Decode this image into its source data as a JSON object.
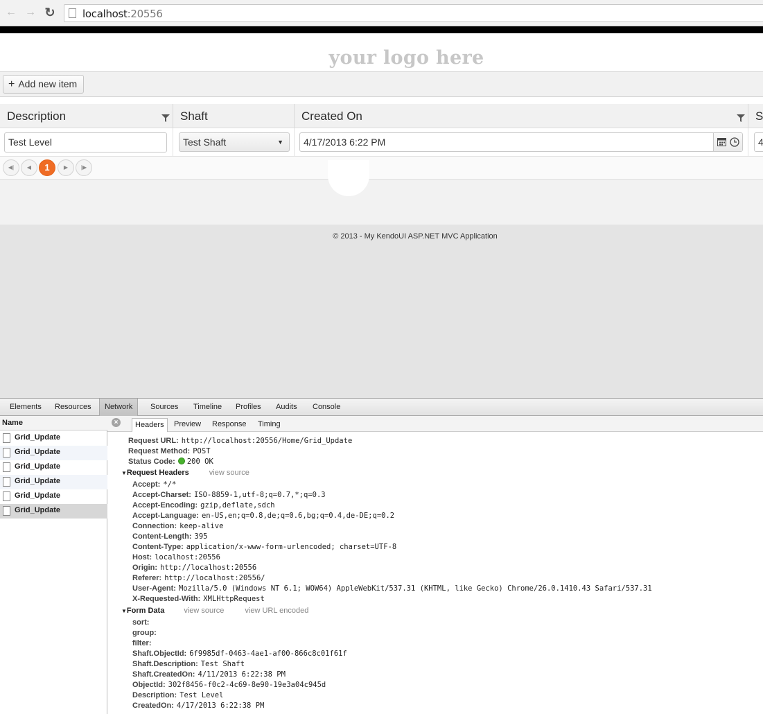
{
  "browser": {
    "url_host": "localhost",
    "url_port": ":20556"
  },
  "site": {
    "logo": "your logo here",
    "add_button": "Add new item",
    "footer": "© 2013 - My KendoUI ASP.NET MVC Application"
  },
  "grid": {
    "columns": [
      "Description",
      "Shaft",
      "Created On",
      "S"
    ],
    "edit_row": {
      "description": "Test Level",
      "shaft": "Test Shaft",
      "created_on": "4/17/2013 6:22 PM",
      "overflow": "4"
    },
    "pager": {
      "current_page": "1"
    }
  },
  "devtools": {
    "tabs": [
      "Elements",
      "Resources",
      "Network",
      "Sources",
      "Timeline",
      "Profiles",
      "Audits",
      "Console"
    ],
    "active_tab": "Network",
    "name_header": "Name",
    "requests": [
      "Grid_Update",
      "Grid_Update",
      "Grid_Update",
      "Grid_Update",
      "Grid_Update",
      "Grid_Update"
    ],
    "sub_tabs": [
      "Headers",
      "Preview",
      "Response",
      "Timing"
    ],
    "general": {
      "request_url_label": "Request URL:",
      "request_url": "http://localhost:20556/Home/Grid_Update",
      "request_method_label": "Request Method:",
      "request_method": "POST",
      "status_code_label": "Status Code:",
      "status_code": "200 OK"
    },
    "request_headers_title": "Request Headers",
    "view_source": "view source",
    "request_headers": [
      {
        "k": "Accept:",
        "v": "*/*"
      },
      {
        "k": "Accept-Charset:",
        "v": "ISO-8859-1,utf-8;q=0.7,*;q=0.3"
      },
      {
        "k": "Accept-Encoding:",
        "v": "gzip,deflate,sdch"
      },
      {
        "k": "Accept-Language:",
        "v": "en-US,en;q=0.8,de;q=0.6,bg;q=0.4,de-DE;q=0.2"
      },
      {
        "k": "Connection:",
        "v": "keep-alive"
      },
      {
        "k": "Content-Length:",
        "v": "395"
      },
      {
        "k": "Content-Type:",
        "v": "application/x-www-form-urlencoded; charset=UTF-8"
      },
      {
        "k": "Host:",
        "v": "localhost:20556"
      },
      {
        "k": "Origin:",
        "v": "http://localhost:20556"
      },
      {
        "k": "Referer:",
        "v": "http://localhost:20556/"
      },
      {
        "k": "User-Agent:",
        "v": "Mozilla/5.0 (Windows NT 6.1; WOW64) AppleWebKit/537.31 (KHTML, like Gecko) Chrome/26.0.1410.43 Safari/537.31"
      },
      {
        "k": "X-Requested-With:",
        "v": "XMLHttpRequest"
      }
    ],
    "form_data_title": "Form Data",
    "view_url_encoded": "view URL encoded",
    "form_data": [
      {
        "k": "sort:",
        "v": ""
      },
      {
        "k": "group:",
        "v": ""
      },
      {
        "k": "filter:",
        "v": ""
      },
      {
        "k": "Shaft.ObjectId:",
        "v": "6f9985df-0463-4ae1-af00-866c8c01f61f"
      },
      {
        "k": "Shaft.Description:",
        "v": "Test Shaft"
      },
      {
        "k": "Shaft.CreatedOn:",
        "v": "4/11/2013 6:22:38 PM"
      },
      {
        "k": "ObjectId:",
        "v": "302f8456-f0c2-4c69-8e90-19e3a04c945d"
      },
      {
        "k": "Description:",
        "v": "Test Level"
      },
      {
        "k": "CreatedOn:",
        "v": "4/17/2013 6:22:38 PM"
      }
    ]
  }
}
